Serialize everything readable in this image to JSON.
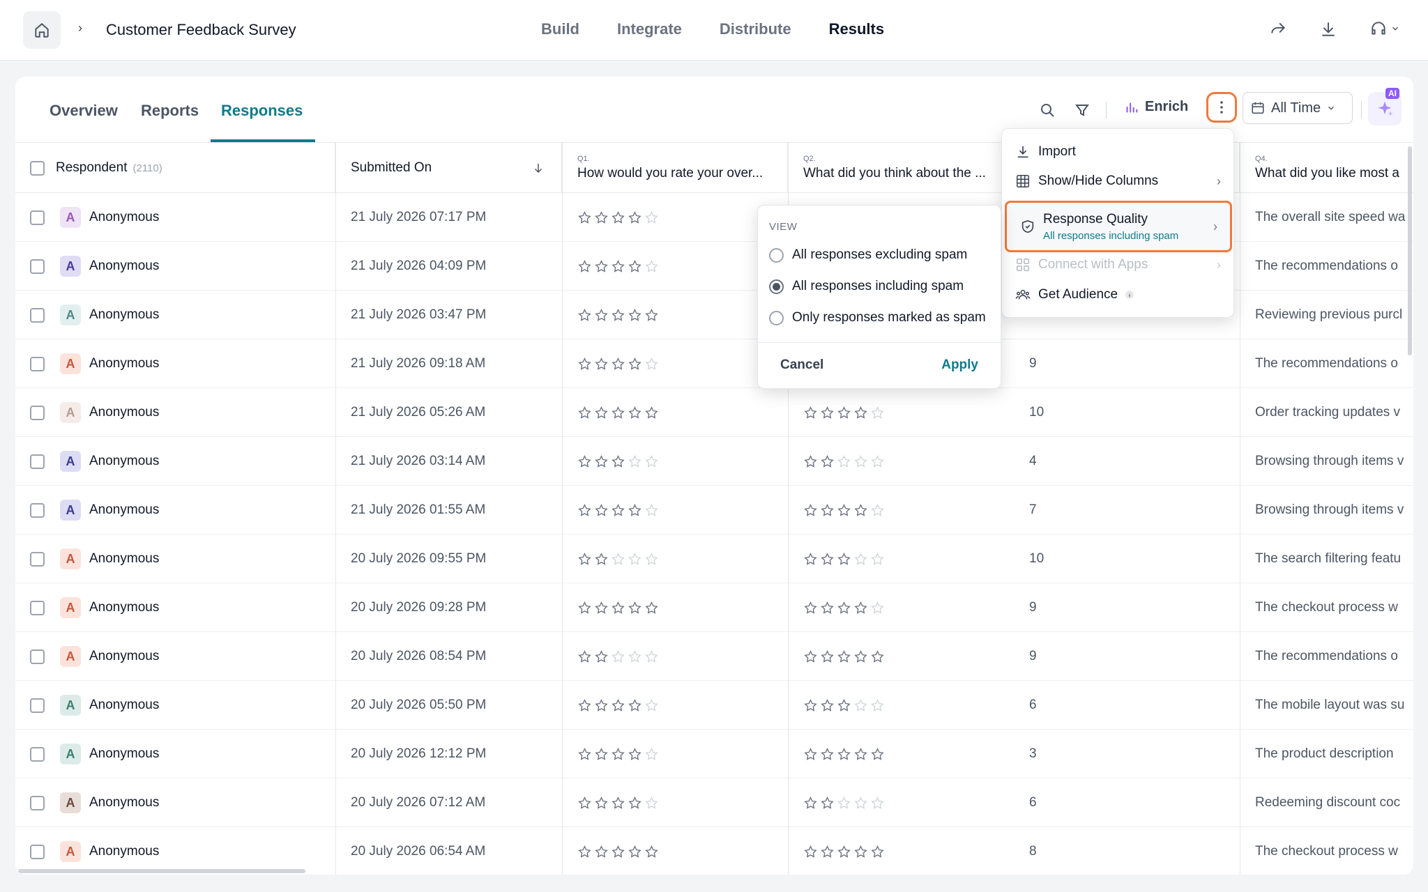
{
  "header": {
    "survey_title": "Customer Feedback Survey",
    "nav": [
      "Build",
      "Integrate",
      "Distribute",
      "Results"
    ],
    "active_nav": "Results"
  },
  "subtabs": [
    "Overview",
    "Reports",
    "Responses"
  ],
  "active_subtab": "Responses",
  "toolbar": {
    "enrich_label": "Enrich",
    "date_filter": "All Time",
    "ai_badge": "AI"
  },
  "columns": {
    "respondent_label": "Respondent",
    "respondent_count": "(2110)",
    "submitted_label": "Submitted On",
    "q1_num": "Q1.",
    "q1_text": "How would you rate your over...",
    "q2_num": "Q2.",
    "q2_text": "What did you think about the ...",
    "q4_num": "Q4.",
    "q4_text": "What did you like most a"
  },
  "menu": {
    "import": "Import",
    "show_hide": "Show/Hide Columns",
    "response_quality": "Response Quality",
    "response_quality_sub": "All responses including spam",
    "connect_apps": "Connect with Apps",
    "get_audience": "Get Audience"
  },
  "quality_popover": {
    "title": "VIEW",
    "options": [
      "All responses excluding spam",
      "All responses including spam",
      "Only responses marked as spam"
    ],
    "selected": 1,
    "cancel": "Cancel",
    "apply": "Apply"
  },
  "rows": [
    {
      "name": "Anonymous",
      "avatar_bg": "#efe3f7",
      "avatar_fg": "#9b59b6",
      "date": "21 July 2026 07:17 PM",
      "q1": 4,
      "q2": null,
      "q3": "",
      "q4": "The overall site speed wa"
    },
    {
      "name": "Anonymous",
      "avatar_bg": "#e0dcf5",
      "avatar_fg": "#4a3a9c",
      "date": "21 July 2026 04:09 PM",
      "q1": 4,
      "q2": null,
      "q3": "",
      "q4": "The recommendations o"
    },
    {
      "name": "Anonymous",
      "avatar_bg": "#e3efef",
      "avatar_fg": "#4f8a8b",
      "date": "21 July 2026 03:47 PM",
      "q1": 5,
      "q2": null,
      "q3": "",
      "q4": "Reviewing previous purcl"
    },
    {
      "name": "Anonymous",
      "avatar_bg": "#fbe3dc",
      "avatar_fg": "#c9553a",
      "date": "21 July 2026 09:18 AM",
      "q1": 4,
      "q2": null,
      "q3": "9",
      "q4": "The recommendations o"
    },
    {
      "name": "Anonymous",
      "avatar_bg": "#f5ecea",
      "avatar_fg": "#b79a94",
      "date": "21 July 2026 05:26 AM",
      "q1": 5,
      "q2": 4,
      "q3": "10",
      "q4": "Order tracking updates v"
    },
    {
      "name": "Anonymous",
      "avatar_bg": "#dcdcf5",
      "avatar_fg": "#3b3b8f",
      "date": "21 July 2026 03:14 AM",
      "q1": 3,
      "q2": 2,
      "q3": "4",
      "q4": "Browsing through items v"
    },
    {
      "name": "Anonymous",
      "avatar_bg": "#dcdcf5",
      "avatar_fg": "#3b3b8f",
      "date": "21 July 2026 01:55 AM",
      "q1": 4,
      "q2": 4,
      "q3": "7",
      "q4": "Browsing through items v"
    },
    {
      "name": "Anonymous",
      "avatar_bg": "#fbe3dc",
      "avatar_fg": "#c9553a",
      "date": "20 July 2026 09:55 PM",
      "q1": 2,
      "q2": 3,
      "q3": "10",
      "q4": "The search filtering featu"
    },
    {
      "name": "Anonymous",
      "avatar_bg": "#fbe3dc",
      "avatar_fg": "#c9553a",
      "date": "20 July 2026 09:28 PM",
      "q1": 5,
      "q2": 4,
      "q3": "9",
      "q4": "The checkout process w"
    },
    {
      "name": "Anonymous",
      "avatar_bg": "#fbe3dc",
      "avatar_fg": "#c9553a",
      "date": "20 July 2026 08:54 PM",
      "q1": 2,
      "q2": 5,
      "q3": "9",
      "q4": "The recommendations o"
    },
    {
      "name": "Anonymous",
      "avatar_bg": "#dcebe8",
      "avatar_fg": "#3e7d73",
      "date": "20 July 2026 05:50 PM",
      "q1": 4,
      "q2": 3,
      "q3": "6",
      "q4": "The mobile layout was su"
    },
    {
      "name": "Anonymous",
      "avatar_bg": "#dcebe8",
      "avatar_fg": "#3e7d73",
      "date": "20 July 2026 12:12 PM",
      "q1": 4,
      "q2": 5,
      "q3": "3",
      "q4": "The product description"
    },
    {
      "name": "Anonymous",
      "avatar_bg": "#e8ddd8",
      "avatar_fg": "#6b4a3c",
      "date": "20 July 2026 07:12 AM",
      "q1": 4,
      "q2": 2,
      "q3": "6",
      "q4": "Redeeming discount coc"
    },
    {
      "name": "Anonymous",
      "avatar_bg": "#fbe3dc",
      "avatar_fg": "#c9553a",
      "date": "20 July 2026 06:54 AM",
      "q1": 5,
      "q2": 5,
      "q3": "8",
      "q4": "The checkout process w"
    }
  ],
  "colors": {
    "accent": "#0f7b8a",
    "highlight_border": "#f07a3a",
    "ai_purple": "#8b5cf6"
  },
  "icons": [
    "home-icon",
    "share-icon",
    "download-icon",
    "headset-icon",
    "search-icon",
    "filter-icon",
    "enrich-icon",
    "kebab-icon",
    "calendar-icon",
    "sparkle-icon",
    "import-icon",
    "columns-icon",
    "shield-icon",
    "apps-icon",
    "audience-icon",
    "info-icon",
    "star-icon",
    "sort-down-icon"
  ]
}
